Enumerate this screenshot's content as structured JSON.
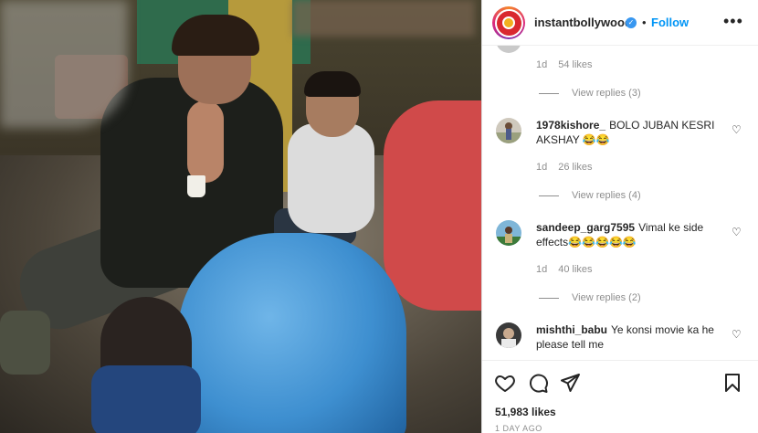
{
  "post": {
    "username": "instantbollywood",
    "verified_mark": "✓",
    "separator": "•",
    "follow_label": "Follow",
    "more_label": "•••",
    "likes": "51,983 likes",
    "date": "1 DAY AGO"
  },
  "first_comment": {
    "time": "1d",
    "likes": "54 likes",
    "replies": "View replies (3)"
  },
  "comments": [
    {
      "username": "1978kishore_",
      "text": "BOLO JUBAN KESRI AKSHAY 😂😂",
      "time": "1d",
      "likes": "26 likes",
      "replies": "View replies (4)"
    },
    {
      "username": "sandeep_garg7595",
      "text": "Vimal ke side effects😂😂😂😂😂",
      "time": "1d",
      "likes": "40 likes",
      "replies": "View replies (2)"
    },
    {
      "username": "mishthi_babu",
      "text": "Ye konsi movie ka he please tell me"
    }
  ],
  "icons": {
    "like": "heart-icon",
    "comment": "comment-icon",
    "share": "paper-plane-icon",
    "save": "bookmark-icon",
    "comment_like": "heart-outline-icon"
  },
  "colors": {
    "follow": "#0095f6",
    "muted": "#8e8e8e",
    "text": "#262626"
  }
}
